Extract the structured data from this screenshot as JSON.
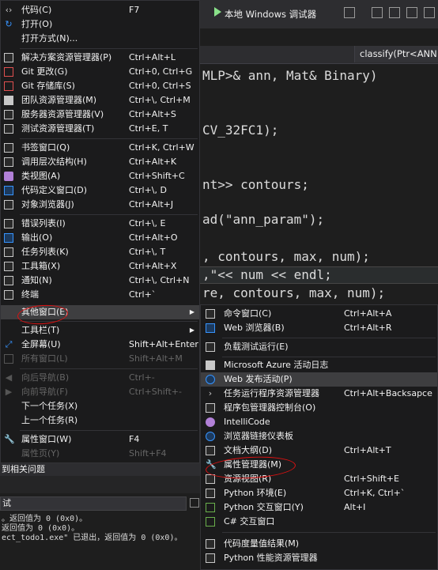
{
  "toolbar": {
    "debug_target": "本地 Windows 调试器"
  },
  "nav": {
    "member": "classify(Ptr<ANN"
  },
  "code": [
    "MLP>& ann, Mat& Binary)",
    "CV_32FC1);",
    "nt>> contours;",
    "ad(\"ann_param\");",
    ", contours, max, num);",
    ",\"<< num << endl;",
    "re, contours, max, num);"
  ],
  "output": {
    "panel_title": "到相关问题",
    "combo": "试",
    "lines": [
      "。返回值为 0 (0x0)。",
      "返回值为 0 (0x0)。",
      "ect_todo1.exe\" 已退出，返回值为 0 (0x0)。"
    ]
  },
  "view_menu": [
    {
      "label": "代码(C)",
      "shortcut": "F7",
      "icon": "code-icon"
    },
    {
      "label": "打开(O)",
      "shortcut": "",
      "icon": "open-arrow-icon"
    },
    {
      "label": "打开方式(N)...",
      "shortcut": "",
      "icon": ""
    },
    {
      "label": "解决方案资源管理器(P)",
      "shortcut": "Ctrl+Alt+L",
      "icon": "solution-explorer-icon"
    },
    {
      "label": "Git 更改(G)",
      "shortcut": "Ctrl+0, Ctrl+G",
      "icon": "git-changes-icon"
    },
    {
      "label": "Git 存储库(S)",
      "shortcut": "Ctrl+0, Ctrl+S",
      "icon": "git-repository-icon"
    },
    {
      "label": "团队资源管理器(M)",
      "shortcut": "Ctrl+\\, Ctrl+M",
      "icon": "team-explorer-icon"
    },
    {
      "label": "服务器资源管理器(V)",
      "shortcut": "Ctrl+Alt+S",
      "icon": "server-explorer-icon"
    },
    {
      "label": "测试资源管理器(T)",
      "shortcut": "Ctrl+E, T",
      "icon": "test-explorer-icon"
    },
    {
      "label": "书签窗口(Q)",
      "shortcut": "Ctrl+K, Ctrl+W",
      "icon": "bookmark-icon"
    },
    {
      "label": "调用层次结构(H)",
      "shortcut": "Ctrl+Alt+K",
      "icon": "call-hierarchy-icon"
    },
    {
      "label": "类视图(A)",
      "shortcut": "Ctrl+Shift+C",
      "icon": "class-view-icon"
    },
    {
      "label": "代码定义窗口(D)",
      "shortcut": "Ctrl+\\, D",
      "icon": "code-definition-icon"
    },
    {
      "label": "对象浏览器(J)",
      "shortcut": "Ctrl+Alt+J",
      "icon": "object-browser-icon"
    },
    {
      "label": "错误列表(I)",
      "shortcut": "Ctrl+\\, E",
      "icon": "error-list-icon"
    },
    {
      "label": "输出(O)",
      "shortcut": "Ctrl+Alt+O",
      "icon": "output-icon"
    },
    {
      "label": "任务列表(K)",
      "shortcut": "Ctrl+\\, T",
      "icon": "task-list-icon"
    },
    {
      "label": "工具箱(X)",
      "shortcut": "Ctrl+Alt+X",
      "icon": "toolbox-icon"
    },
    {
      "label": "通知(N)",
      "shortcut": "Ctrl+\\, Ctrl+N",
      "icon": "notification-icon"
    },
    {
      "label": "终端",
      "shortcut": "Ctrl+`",
      "icon": "terminal-icon"
    },
    {
      "label": "其他窗口(E)",
      "shortcut": "",
      "icon": ""
    },
    {
      "label": "工具栏(T)",
      "shortcut": "",
      "icon": ""
    },
    {
      "label": "全屏幕(U)",
      "shortcut": "Shift+Alt+Enter",
      "icon": "fullscreen-icon"
    },
    {
      "label": "所有窗口(L)",
      "shortcut": "Shift+Alt+M",
      "icon": "all-windows-icon"
    },
    {
      "label": "向后导航(B)",
      "shortcut": "Ctrl+-",
      "icon": "navigate-back-icon"
    },
    {
      "label": "向前导航(F)",
      "shortcut": "Ctrl+Shift+-",
      "icon": "navigate-forward-icon"
    },
    {
      "label": "下一个任务(X)",
      "shortcut": "",
      "icon": ""
    },
    {
      "label": "上一个任务(R)",
      "shortcut": "",
      "icon": ""
    },
    {
      "label": "属性窗口(W)",
      "shortcut": "F4",
      "icon": "wrench-icon"
    },
    {
      "label": "属性页(Y)",
      "shortcut": "Shift+F4",
      "icon": ""
    }
  ],
  "other_windows_menu": [
    {
      "label": "命令窗口(C)",
      "shortcut": "Ctrl+Alt+A",
      "icon": "command-window-icon"
    },
    {
      "label": "Web 浏览器(B)",
      "shortcut": "Ctrl+Alt+R",
      "icon": "web-browser-icon"
    },
    {
      "label": "负载测试运行(E)",
      "shortcut": "",
      "icon": "load-test-icon"
    },
    {
      "label": "Microsoft Azure 活动日志",
      "shortcut": "",
      "icon": "azure-log-icon"
    },
    {
      "label": "Web 发布活动(P)",
      "shortcut": "",
      "icon": "web-publish-icon"
    },
    {
      "label": "任务运行程序资源管理器",
      "shortcut": "Ctrl+Alt+Backsapce",
      "icon": "task-runner-icon"
    },
    {
      "label": "程序包管理器控制台(O)",
      "shortcut": "",
      "icon": "package-console-icon"
    },
    {
      "label": "IntelliCode",
      "shortcut": "",
      "icon": "intellicode-icon"
    },
    {
      "label": "浏览器链接仪表板",
      "shortcut": "",
      "icon": "browser-link-icon"
    },
    {
      "label": "文档大纲(D)",
      "shortcut": "Ctrl+Alt+T",
      "icon": "document-outline-icon"
    },
    {
      "label": "属性管理器(M)",
      "shortcut": "",
      "icon": "property-manager-icon"
    },
    {
      "label": "资源视图(R)",
      "shortcut": "Ctrl+Shift+E",
      "icon": "resource-view-icon"
    },
    {
      "label": "Python 环境(E)",
      "shortcut": "Ctrl+K, Ctrl+`",
      "icon": "python-env-icon"
    },
    {
      "label": "Python 交互窗口(Y)",
      "shortcut": "Alt+I",
      "icon": "python-interactive-icon"
    },
    {
      "label": "C# 交互窗口",
      "shortcut": "",
      "icon": "csharp-interactive-icon"
    },
    {
      "label": "代码度量值结果(M)",
      "shortcut": "",
      "icon": "code-metrics-icon"
    },
    {
      "label": "Python 性能资源管理器",
      "shortcut": "",
      "icon": "python-profiler-icon"
    }
  ]
}
